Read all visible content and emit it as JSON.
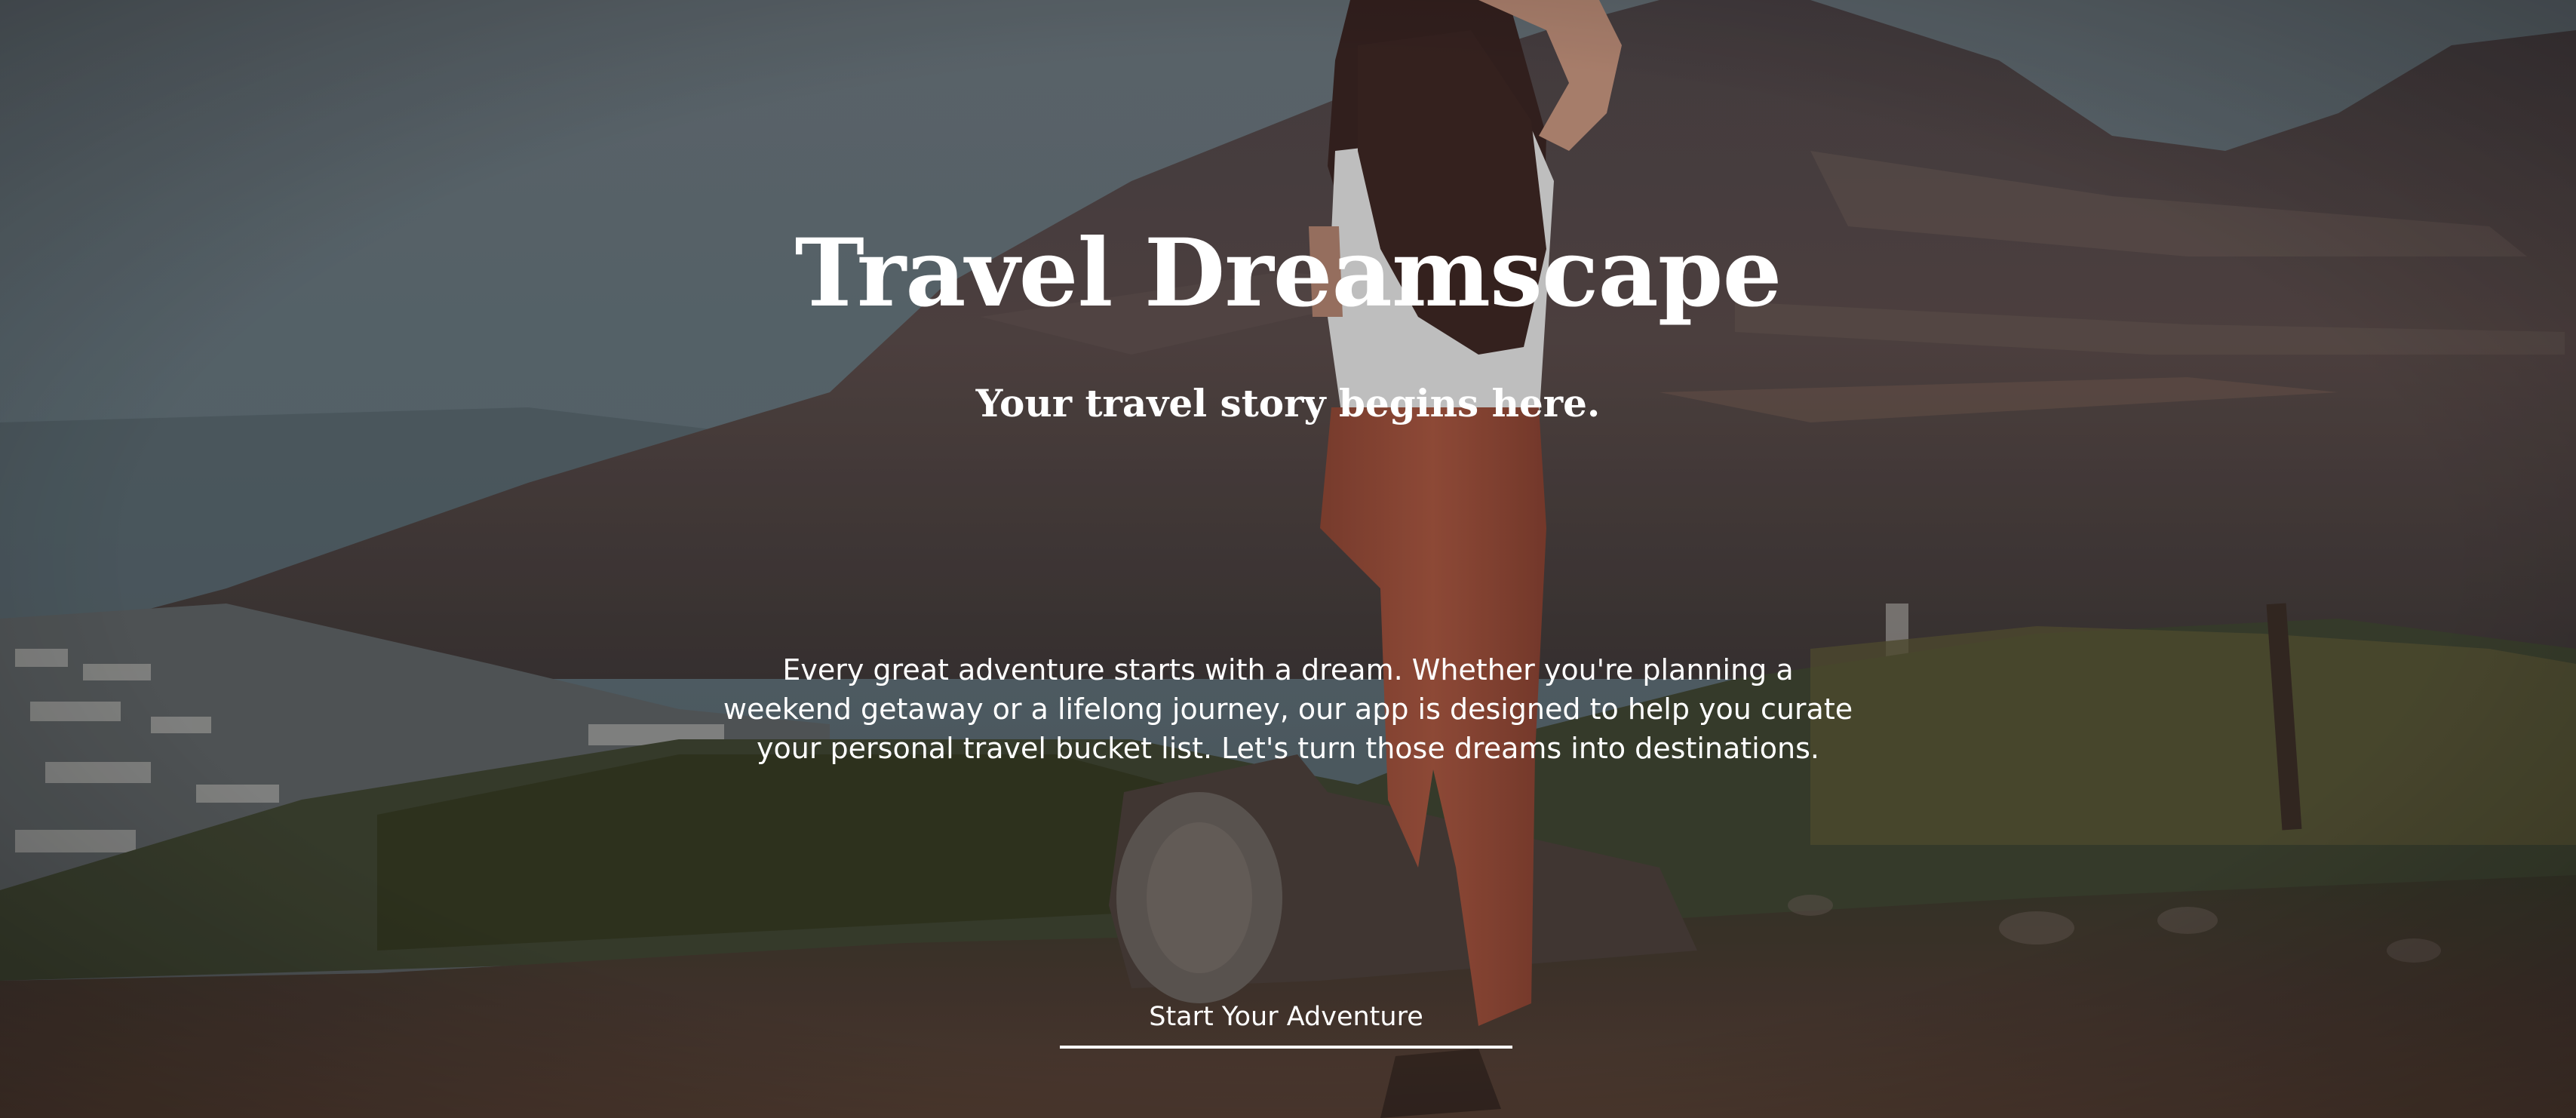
{
  "hero": {
    "title": "Travel Dreamscape",
    "subtitle": "Your travel story begins here.",
    "description": "Every great adventure starts with a dream. Whether you're planning a weekend getaway or a lifelong journey, our app is designed to help you curate your personal travel bucket list. Let's turn those dreams into destinations.",
    "cta_label": "Start Your Adventure",
    "background_image": "woman-overlooking-mountain-valley-photo"
  },
  "colors": {
    "text": "#ffffff",
    "sky": "#6f7c82",
    "mountain": "#5a4a48",
    "pants": "#a8543d",
    "ground": "#4a3a32"
  }
}
